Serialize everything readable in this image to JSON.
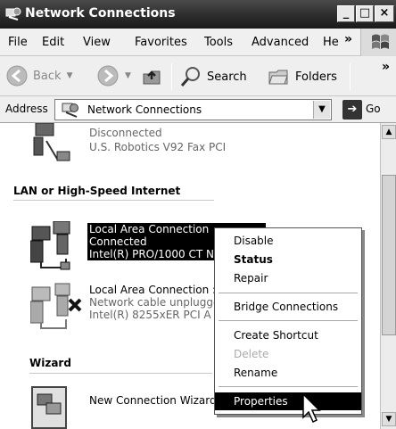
{
  "window": {
    "title": "Network Connections"
  },
  "menubar": {
    "items": [
      "File",
      "Edit",
      "View",
      "Favorites",
      "Tools",
      "Advanced",
      "He"
    ],
    "overflow": "»"
  },
  "toolbar": {
    "back": "Back",
    "search": "Search",
    "folders": "Folders",
    "overflow": "»"
  },
  "address": {
    "label": "Address",
    "value": "Network Connections",
    "go": "Go"
  },
  "content": {
    "fax": {
      "status": "Disconnected",
      "device": "U.S. Robotics V92 Fax PCI"
    },
    "lan_section": "LAN or High-Speed Internet",
    "lan1": {
      "name": "Local Area Connection",
      "status": "Connected",
      "device": "Intel(R) PRO/1000 CT N"
    },
    "lan2": {
      "name": "Local Area Connection :",
      "status": "Network cable unplugge",
      "device": "Intel(R) 8255xER PCI A"
    },
    "wizard_section": "Wizard",
    "wizard": {
      "name": "New Connection Wizard"
    }
  },
  "context_menu": {
    "items": [
      "Disable",
      "Status",
      "Repair",
      "Bridge Connections",
      "Create Shortcut",
      "Delete",
      "Rename",
      "Properties"
    ]
  }
}
